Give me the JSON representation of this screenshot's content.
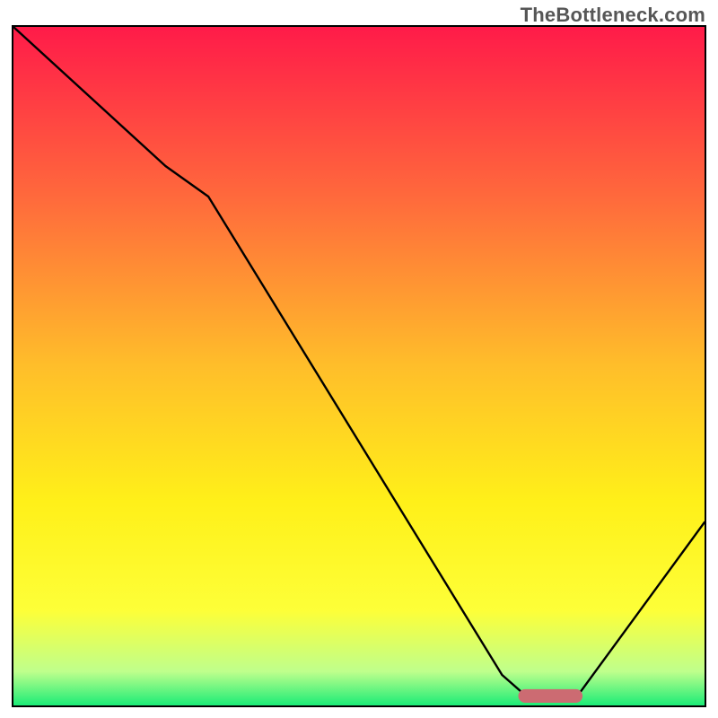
{
  "attribution": "TheBottleneck.com",
  "chart_data": {
    "type": "line",
    "title": "",
    "xlabel": "",
    "ylabel": "",
    "xlim": [
      0,
      100
    ],
    "ylim": [
      0,
      100
    ],
    "grid": false,
    "legend": false,
    "gradient_stops": [
      {
        "offset": 0.0,
        "color": "#ff1b49"
      },
      {
        "offset": 0.25,
        "color": "#ff693c"
      },
      {
        "offset": 0.5,
        "color": "#ffbe2a"
      },
      {
        "offset": 0.7,
        "color": "#fff019"
      },
      {
        "offset": 0.86,
        "color": "#fdff38"
      },
      {
        "offset": 0.95,
        "color": "#bfff8c"
      },
      {
        "offset": 1.0,
        "color": "#1cec77"
      }
    ],
    "series": [
      {
        "name": "curve",
        "x": [
          0,
          22,
          28.2,
          70.7,
          74.5,
          81.4,
          100
        ],
        "y": [
          100,
          79.5,
          75,
          4.5,
          1.1,
          1.1,
          27
        ]
      }
    ],
    "marker": {
      "shape": "capsule",
      "x_center": 77.7,
      "y": 1.4,
      "width": 9.3,
      "height": 2.0,
      "color": "#cc6b72"
    }
  }
}
